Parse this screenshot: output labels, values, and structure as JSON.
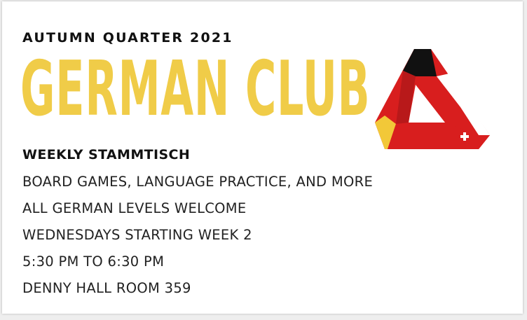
{
  "header": {
    "quarter_label": "AUTUMN QUARTER 2021",
    "club_title": "GERMAN CLUB"
  },
  "event": {
    "name": "WEEKLY STAMMTISCH",
    "details": [
      "BOARD GAMES, LANGUAGE PRACTICE, AND MORE",
      "ALL GERMAN LEVELS WELCOME",
      "WEDNESDAYS STARTING WEEK 2",
      "5:30 PM TO 6:30 PM",
      "DENNY HALL ROOM 359"
    ]
  },
  "logo": {
    "icon": "penrose-triangle-flags-icon",
    "colors": {
      "black": "#111111",
      "red": "#d81e1e",
      "gold": "#f2c838",
      "white": "#ffffff"
    }
  },
  "colors": {
    "title_yellow": "#f0cc48",
    "text_dark": "#111111"
  }
}
